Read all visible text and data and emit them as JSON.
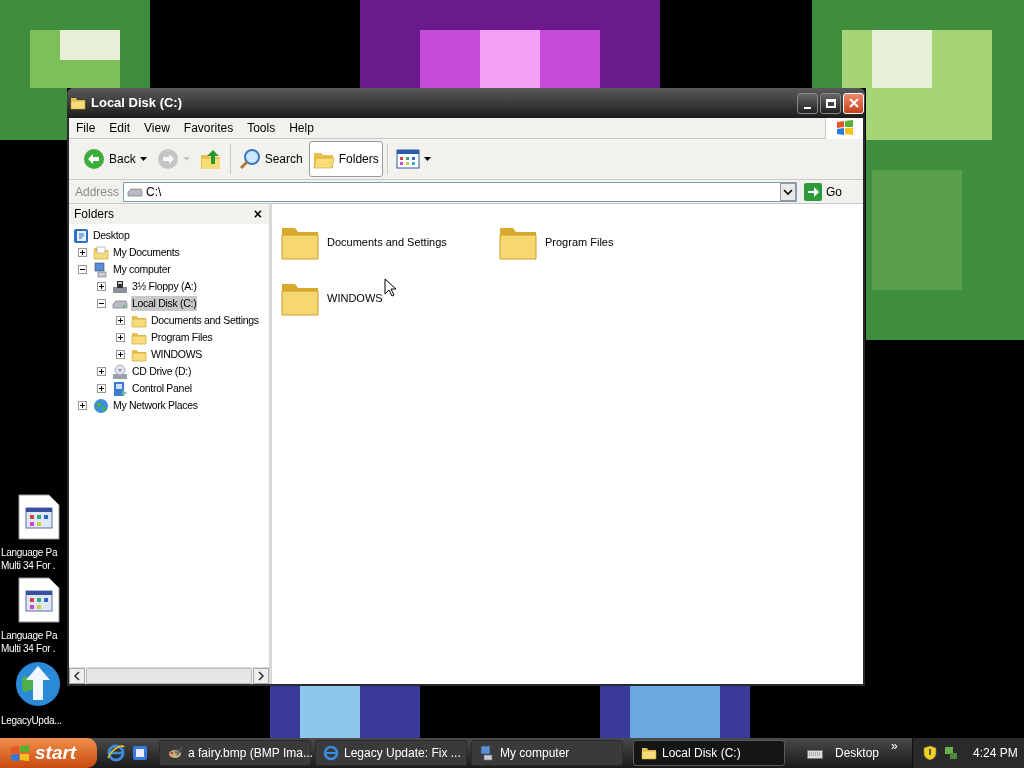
{
  "desktop_icons": [
    {
      "kind": "document",
      "label_lines": [
        "Language Pa",
        "Multi 34 For ."
      ]
    },
    {
      "kind": "document",
      "label_lines": [
        "Language Pa",
        "Multi 34 For ."
      ]
    },
    {
      "kind": "globe",
      "label_lines": [
        "LegacyUpda..."
      ]
    }
  ],
  "window": {
    "title": "Local Disk (C:)"
  },
  "menu": [
    "File",
    "Edit",
    "View",
    "Favorites",
    "Tools",
    "Help"
  ],
  "toolbar": [
    {
      "kind": "back",
      "label": "Back",
      "pressed": false,
      "disabled": false
    },
    {
      "kind": "forward",
      "pressed": false,
      "disabled": true
    },
    {
      "kind": "up",
      "pressed": false,
      "disabled": false
    },
    {
      "kind": "search",
      "label": "Search",
      "pressed": false,
      "disabled": false
    },
    {
      "kind": "folders",
      "label": "Folders",
      "pressed": true,
      "disabled": false
    },
    {
      "kind": "views",
      "pressed": false,
      "disabled": false
    }
  ],
  "address": {
    "label": "Address",
    "value": "C:\\",
    "go": "Go"
  },
  "folders_pane": {
    "title": "Folders",
    "close": "×",
    "tree": [
      {
        "label": "Desktop",
        "kind": "desktop",
        "selected": false,
        "children": [
          {
            "label": "My Documents",
            "kind": "documents",
            "expanded": false,
            "selected": false
          },
          {
            "label": "My computer",
            "kind": "computer",
            "expanded": true,
            "selected": false,
            "children": [
              {
                "label": "3½ Floppy (A:)",
                "kind": "floppy",
                "expanded": false,
                "selected": false
              },
              {
                "label": "Local Disk (C:)",
                "kind": "drive",
                "expanded": true,
                "selected": true,
                "children": [
                  {
                    "label": "Documents and Settings",
                    "kind": "folder",
                    "expanded": false,
                    "selected": false
                  },
                  {
                    "label": "Program Files",
                    "kind": "folder",
                    "expanded": false,
                    "selected": false
                  },
                  {
                    "label": "WINDOWS",
                    "kind": "folder",
                    "expanded": false,
                    "selected": false
                  }
                ]
              },
              {
                "label": "CD Drive (D:)",
                "kind": "cd",
                "expanded": false,
                "selected": false
              },
              {
                "label": "Control Panel",
                "kind": "control",
                "expanded": false,
                "selected": false
              }
            ]
          },
          {
            "label": "My Network Places",
            "kind": "network",
            "expanded": false,
            "selected": false
          }
        ]
      }
    ]
  },
  "files": [
    {
      "label": "Documents and Settings"
    },
    {
      "label": "Program Files"
    },
    {
      "label": "WINDOWS"
    }
  ],
  "taskbar": {
    "start": "start",
    "tasks": [
      {
        "label": "a fairy.bmp (BMP Ima...",
        "kind": "image",
        "selected": false
      },
      {
        "label": "Legacy Update: Fix ...",
        "kind": "browser",
        "selected": false
      },
      {
        "label": "My computer",
        "kind": "computer",
        "selected": false
      },
      {
        "label": "Local Disk (C:)",
        "kind": "folder",
        "selected": true
      }
    ],
    "toolbar_label": "Desktop",
    "chevron": "»",
    "clock": "4:24 PM"
  }
}
